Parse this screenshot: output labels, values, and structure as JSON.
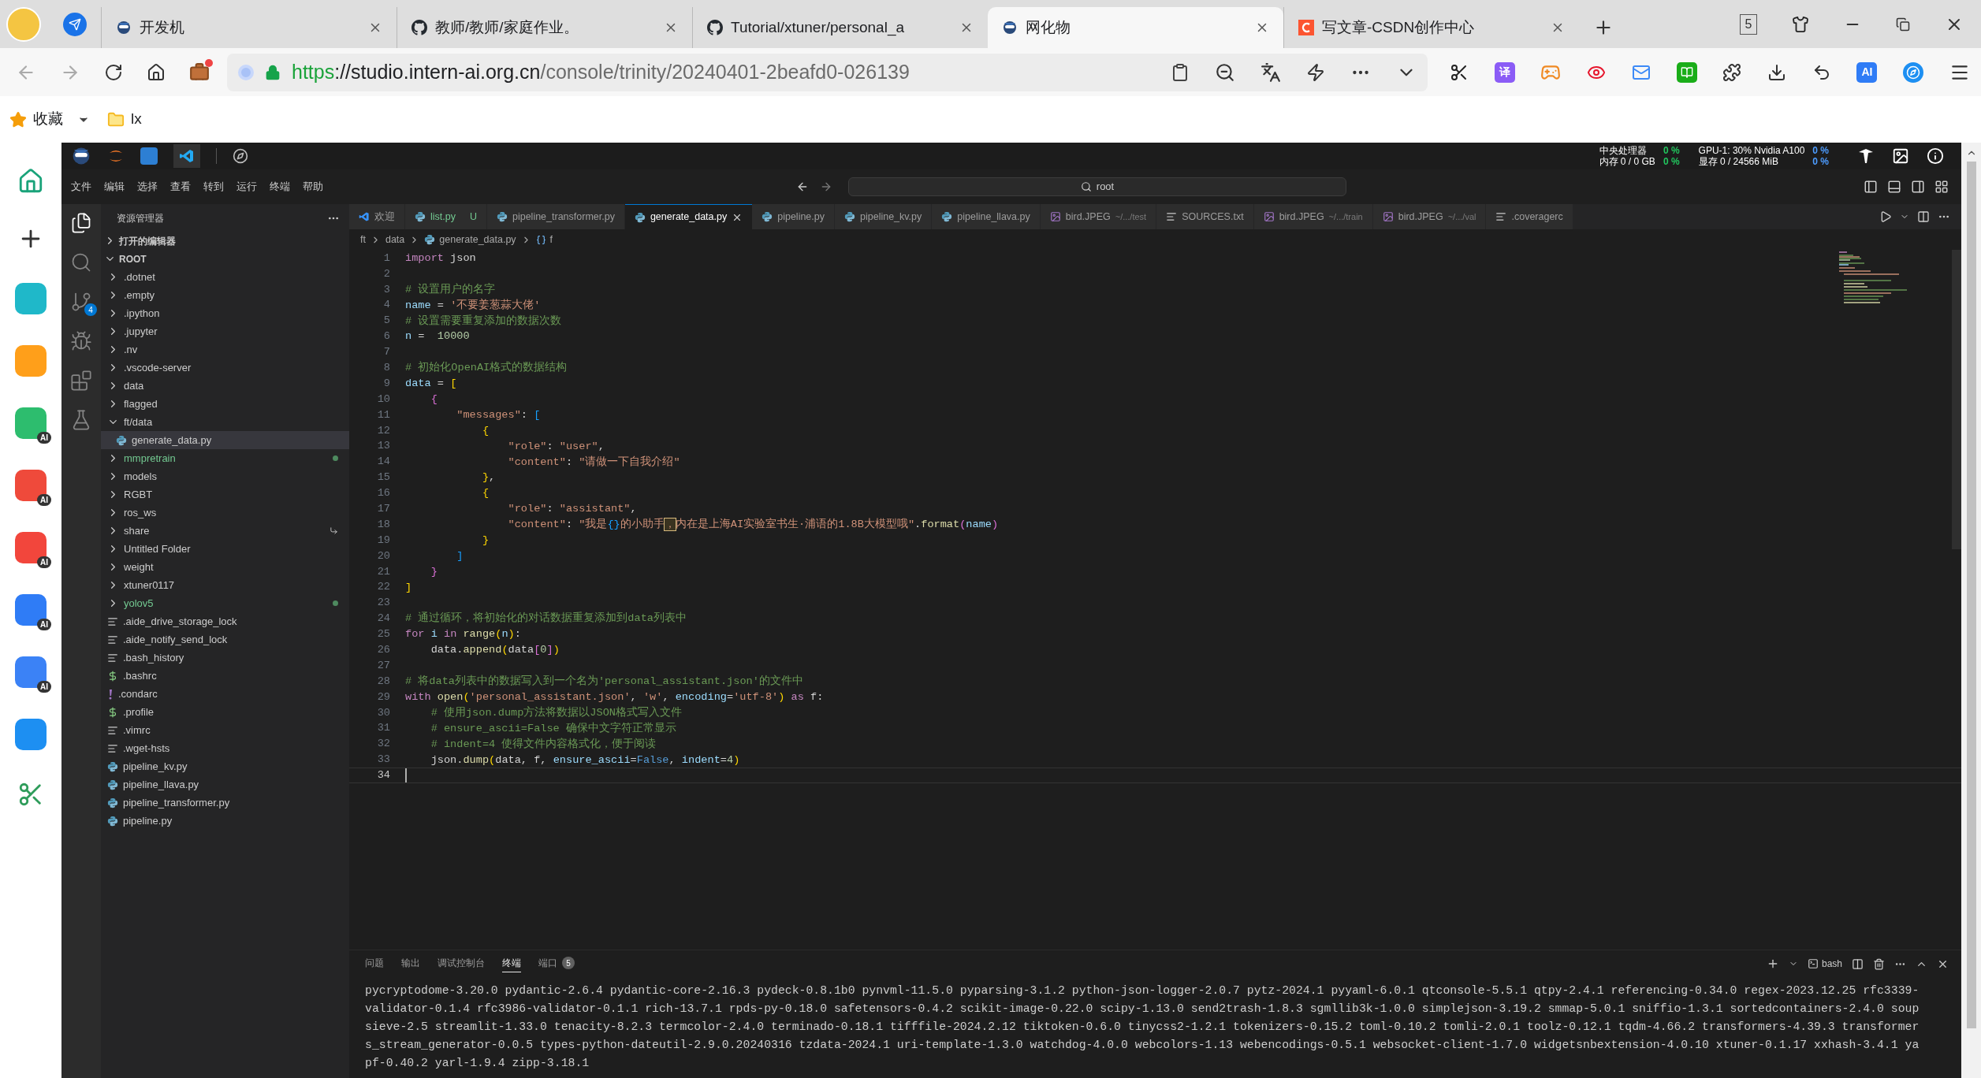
{
  "browser": {
    "tabs": [
      {
        "label": "开发机",
        "selected": false
      },
      {
        "label": "教师/教师/家庭作业。",
        "selected": false
      },
      {
        "label": "Tutorial/xtuner/personal_a",
        "selected": false
      },
      {
        "label": "网化物",
        "selected": true
      },
      {
        "label": "写文章-CSDN创作中心",
        "selected": false
      }
    ],
    "tab_count": "5",
    "address": {
      "scheme": "https",
      "host": "://studio.intern-ai.org.cn",
      "path": "/console/trinity/20240401-2beafd0-026139"
    },
    "extensions": [
      {
        "kind": "scissors"
      },
      {
        "kind": "badge",
        "label": "译",
        "color": "#8b5cf6"
      },
      {
        "kind": "gamepad"
      },
      {
        "kind": "weibo"
      },
      {
        "kind": "mail"
      },
      {
        "kind": "book"
      },
      {
        "kind": "puzzle"
      },
      {
        "kind": "download"
      },
      {
        "kind": "undo"
      },
      {
        "kind": "badge",
        "label": "AI",
        "color": "#2f7cf6"
      },
      {
        "kind": "compass"
      },
      {
        "kind": "menu"
      }
    ],
    "bookmarks": [
      {
        "label": "收藏",
        "kind": "star"
      },
      {
        "label": "lx",
        "kind": "folder"
      }
    ],
    "side_apps": [
      {
        "kind": "home"
      },
      {
        "kind": "add"
      },
      {
        "kind": "app",
        "color": "#1fb8c9"
      },
      {
        "kind": "app",
        "color": "#ff9f1a"
      },
      {
        "kind": "app",
        "color": "#2dbd6e",
        "badge": "AI"
      },
      {
        "kind": "app",
        "color": "#ef4a3b",
        "badge": "AI"
      },
      {
        "kind": "app",
        "color": "#f2463c",
        "badge": "AI"
      },
      {
        "kind": "app",
        "color": "#2f7cf6",
        "badge": "AI"
      },
      {
        "kind": "app",
        "color": "#3b82f6",
        "badge": "AI"
      },
      {
        "kind": "app",
        "color": "#1d8ff2"
      },
      {
        "kind": "scissors"
      }
    ]
  },
  "ide": {
    "monitor": [
      {
        "label": "中央处理器",
        "value": "0 %",
        "color": "#22c55e"
      },
      {
        "label": "内存 0 / 0 GB",
        "value": "0 %",
        "color": "#22c55e"
      },
      {
        "label": "GPU-1: 30% Nvidia A100",
        "value": "0 %",
        "color": "#4d9cff"
      },
      {
        "label": "显存 0 / 24566 MiB",
        "value": "0 %",
        "color": "#4d9cff"
      }
    ],
    "menu": [
      "文件",
      "编辑",
      "选择",
      "查看",
      "转到",
      "运行",
      "终端",
      "帮助"
    ],
    "command_center": "root",
    "activity": [
      {
        "kind": "explorer",
        "selected": true
      },
      {
        "kind": "search",
        "selected": false
      },
      {
        "kind": "scm",
        "selected": false,
        "badge": "4"
      },
      {
        "kind": "debug",
        "selected": false
      },
      {
        "kind": "extensions",
        "selected": false
      },
      {
        "kind": "testing",
        "selected": false
      }
    ],
    "explorer": {
      "title": "资源管理器",
      "open_editors": {
        "label": "打开的编辑器",
        "expanded": false
      },
      "root": {
        "label": "ROOT",
        "expanded": true,
        "children": [
          {
            "label": ".dotnet",
            "kind": "folder",
            "expanded": false,
            "selected": false,
            "modified": false,
            "linked": false
          },
          {
            "label": ".empty",
            "kind": "folder",
            "expanded": false,
            "selected": false,
            "modified": false,
            "linked": false
          },
          {
            "label": ".ipython",
            "kind": "folder",
            "expanded": false,
            "selected": false,
            "modified": false,
            "linked": false
          },
          {
            "label": ".jupyter",
            "kind": "folder",
            "expanded": false,
            "selected": false,
            "modified": false,
            "linked": false
          },
          {
            "label": ".nv",
            "kind": "folder",
            "expanded": false,
            "selected": false,
            "modified": false,
            "linked": false
          },
          {
            "label": ".vscode-server",
            "kind": "folder",
            "expanded": false,
            "selected": false,
            "modified": false,
            "linked": false
          },
          {
            "label": "data",
            "kind": "folder",
            "expanded": false,
            "selected": false,
            "modified": false,
            "linked": false
          },
          {
            "label": "flagged",
            "kind": "folder",
            "expanded": false,
            "selected": false,
            "modified": false,
            "linked": false
          },
          {
            "label": "ft/data",
            "kind": "folder",
            "expanded": true,
            "selected": false,
            "modified": false,
            "linked": false,
            "children": [
              {
                "label": "generate_data.py",
                "kind": "python",
                "selected": true
              }
            ]
          },
          {
            "label": "mmpretrain",
            "kind": "folder",
            "expanded": false,
            "selected": false,
            "modified": true,
            "linked": false
          },
          {
            "label": "models",
            "kind": "folder",
            "expanded": false,
            "selected": false,
            "modified": false,
            "linked": false
          },
          {
            "label": "RGBT",
            "kind": "folder",
            "expanded": false,
            "selected": false,
            "modified": false,
            "linked": false
          },
          {
            "label": "ros_ws",
            "kind": "folder",
            "expanded": false,
            "selected": false,
            "modified": false,
            "linked": false
          },
          {
            "label": "share",
            "kind": "folder",
            "expanded": false,
            "selected": false,
            "modified": false,
            "linked": true
          },
          {
            "label": "Untitled Folder",
            "kind": "folder",
            "expanded": false,
            "selected": false,
            "modified": false,
            "linked": false
          },
          {
            "label": "weight",
            "kind": "folder",
            "expanded": false,
            "selected": false,
            "modified": false,
            "linked": false
          },
          {
            "label": "xtuner0117",
            "kind": "folder",
            "expanded": false,
            "selected": false,
            "modified": false,
            "linked": false
          },
          {
            "label": "yolov5",
            "kind": "folder",
            "expanded": false,
            "selected": false,
            "modified": true,
            "linked": false
          },
          {
            "label": ".aide_drive_storage_lock",
            "kind": "text",
            "selected": false,
            "modified": false,
            "linked": false
          },
          {
            "label": ".aide_notify_send_lock",
            "kind": "text",
            "selected": false,
            "modified": false,
            "linked": false
          },
          {
            "label": ".bash_history",
            "kind": "text",
            "selected": false,
            "modified": false,
            "linked": false
          },
          {
            "label": ".bashrc",
            "kind": "shell",
            "selected": false,
            "modified": false,
            "linked": false
          },
          {
            "label": ".condarc",
            "kind": "config",
            "selected": false,
            "modified": false,
            "linked": false
          },
          {
            "label": ".profile",
            "kind": "shell",
            "selected": false,
            "modified": false,
            "linked": false
          },
          {
            "label": ".vimrc",
            "kind": "text",
            "selected": false,
            "modified": false,
            "linked": false
          },
          {
            "label": ".wget-hsts",
            "kind": "text",
            "selected": false,
            "modified": false,
            "linked": false
          },
          {
            "label": "pipeline_kv.py",
            "kind": "python",
            "selected": false,
            "modified": false,
            "linked": false
          },
          {
            "label": "pipeline_llava.py",
            "kind": "python",
            "selected": false,
            "modified": false,
            "linked": false
          },
          {
            "label": "pipeline_transformer.py",
            "kind": "python",
            "selected": false,
            "modified": false,
            "linked": false
          },
          {
            "label": "pipeline.py",
            "kind": "python",
            "selected": false,
            "modified": false,
            "linked": false
          }
        ]
      }
    },
    "tabs": [
      {
        "label": "欢迎",
        "kind": "welcome",
        "selected": false
      },
      {
        "label": "list.py",
        "kind": "python",
        "status": "U",
        "selected": false
      },
      {
        "label": "pipeline_transformer.py",
        "kind": "python",
        "selected": false
      },
      {
        "label": "generate_data.py",
        "kind": "python",
        "selected": true
      },
      {
        "label": "pipeline.py",
        "kind": "python",
        "selected": false
      },
      {
        "label": "pipeline_kv.py",
        "kind": "python",
        "selected": false
      },
      {
        "label": "pipeline_llava.py",
        "kind": "python",
        "selected": false
      },
      {
        "label": "bird.JPEG",
        "description": "~/.../test",
        "kind": "image",
        "selected": false
      },
      {
        "label": "SOURCES.txt",
        "kind": "text",
        "selected": false
      },
      {
        "label": "bird.JPEG",
        "description": "~/.../train",
        "kind": "image",
        "selected": false
      },
      {
        "label": "bird.JPEG",
        "description": "~/.../val",
        "kind": "image",
        "selected": false
      },
      {
        "label": ".coveragerc",
        "kind": "text",
        "selected": false
      }
    ],
    "breadcrumb": [
      {
        "label": "ft",
        "kind": "folder"
      },
      {
        "label": "data",
        "kind": "folder"
      },
      {
        "label": "generate_data.py",
        "kind": "python"
      },
      {
        "label": "f",
        "kind": "variable"
      }
    ],
    "lines": [
      {
        "number": "1",
        "current": false,
        "tokens": [
          {
            "kind": "kw",
            "text": "import"
          },
          {
            "kind": "plain",
            "text": " json"
          }
        ]
      },
      {
        "number": "2",
        "current": false
      },
      {
        "number": "3",
        "current": false,
        "tokens": [
          {
            "kind": "com",
            "text": "# 设置用户的名字"
          }
        ]
      },
      {
        "number": "4",
        "current": false,
        "tokens": [
          {
            "kind": "var",
            "text": "name"
          },
          {
            "kind": "plain",
            "text": " = "
          },
          {
            "kind": "str",
            "text": "'不要姜葱蒜大佬'"
          }
        ]
      },
      {
        "number": "5",
        "current": false,
        "tokens": [
          {
            "kind": "com",
            "text": "# 设置需要重复添加的数据次数"
          }
        ]
      },
      {
        "number": "6",
        "current": false,
        "tokens": [
          {
            "kind": "var",
            "text": "n"
          },
          {
            "kind": "plain",
            "text": " =  "
          },
          {
            "kind": "num",
            "text": "10000"
          }
        ]
      },
      {
        "number": "7",
        "current": false
      },
      {
        "number": "8",
        "current": false,
        "tokens": [
          {
            "kind": "com",
            "text": "# 初始化OpenAI格式的数据结构"
          }
        ]
      },
      {
        "number": "9",
        "current": false,
        "tokens": [
          {
            "kind": "var",
            "text": "data"
          },
          {
            "kind": "plain",
            "text": " = "
          },
          {
            "kind": "b1",
            "text": "["
          }
        ]
      },
      {
        "number": "10",
        "current": false,
        "tokens": [
          {
            "kind": "b2",
            "text": "    {"
          }
        ]
      },
      {
        "number": "11",
        "current": false,
        "tokens": [
          {
            "kind": "str",
            "text": "        \"messages\""
          },
          {
            "kind": "plain",
            "text": ": "
          },
          {
            "kind": "b3",
            "text": "["
          }
        ]
      },
      {
        "number": "12",
        "current": false,
        "tokens": [
          {
            "kind": "b1",
            "text": "            {"
          }
        ]
      },
      {
        "number": "13",
        "current": false,
        "tokens": [
          {
            "kind": "str",
            "text": "                \"role\""
          },
          {
            "kind": "plain",
            "text": ": "
          },
          {
            "kind": "str",
            "text": "\"user\""
          },
          {
            "kind": "plain",
            "text": ","
          }
        ]
      },
      {
        "number": "14",
        "current": false,
        "tokens": [
          {
            "kind": "str",
            "text": "                \"content\""
          },
          {
            "kind": "plain",
            "text": ": "
          },
          {
            "kind": "str",
            "text": "\"请做一下自我介绍\""
          }
        ]
      },
      {
        "number": "15",
        "current": false,
        "tokens": [
          {
            "kind": "b1",
            "text": "            }"
          },
          {
            "kind": "plain",
            "text": ","
          }
        ]
      },
      {
        "number": "16",
        "current": false,
        "tokens": [
          {
            "kind": "b1",
            "text": "            {"
          }
        ]
      },
      {
        "number": "17",
        "current": false,
        "tokens": [
          {
            "kind": "str",
            "text": "                \"role\""
          },
          {
            "kind": "plain",
            "text": ": "
          },
          {
            "kind": "str",
            "text": "\"assistant\""
          },
          {
            "kind": "plain",
            "text": ","
          }
        ]
      },
      {
        "number": "18",
        "current": false,
        "tokens": [
          {
            "kind": "str",
            "text": "                \"content\""
          },
          {
            "kind": "plain",
            "text": ": "
          },
          {
            "kind": "str",
            "text": "\"我是"
          },
          {
            "kind": "b3",
            "text": "{}"
          },
          {
            "kind": "str",
            "text": "的小助手"
          },
          {
            "kind": "hl",
            "text": "，"
          },
          {
            "kind": "str",
            "text": "内在是上海AI实验室书生·浦语的1.8B大模型哦\""
          },
          {
            "kind": "plain",
            "text": "."
          },
          {
            "kind": "fn",
            "text": "format"
          },
          {
            "kind": "b2",
            "text": "("
          },
          {
            "kind": "var",
            "text": "name"
          },
          {
            "kind": "b2",
            "text": ")"
          }
        ]
      },
      {
        "number": "19",
        "current": false,
        "tokens": [
          {
            "kind": "b1",
            "text": "            }"
          }
        ]
      },
      {
        "number": "20",
        "current": false,
        "tokens": [
          {
            "kind": "b3",
            "text": "        ]"
          }
        ]
      },
      {
        "number": "21",
        "current": false,
        "tokens": [
          {
            "kind": "b2",
            "text": "    }"
          }
        ]
      },
      {
        "number": "22",
        "current": false,
        "tokens": [
          {
            "kind": "b1",
            "text": "]"
          }
        ]
      },
      {
        "number": "23",
        "current": false
      },
      {
        "number": "24",
        "current": false,
        "tokens": [
          {
            "kind": "com",
            "text": "# 通过循环，将初始化的对话数据重复添加到data列表中"
          }
        ]
      },
      {
        "number": "25",
        "current": false,
        "tokens": [
          {
            "kind": "kw",
            "text": "for"
          },
          {
            "kind": "var",
            "text": " i"
          },
          {
            "kind": "kw",
            "text": " in"
          },
          {
            "kind": "fn",
            "text": " range"
          },
          {
            "kind": "b1",
            "text": "("
          },
          {
            "kind": "var",
            "text": "n"
          },
          {
            "kind": "b1",
            "text": ")"
          },
          {
            "kind": "plain",
            "text": ":"
          }
        ]
      },
      {
        "number": "26",
        "current": false,
        "tokens": [
          {
            "kind": "plain",
            "text": "    data."
          },
          {
            "kind": "fn",
            "text": "append"
          },
          {
            "kind": "b1",
            "text": "("
          },
          {
            "kind": "plain",
            "text": "data"
          },
          {
            "kind": "b2",
            "text": "["
          },
          {
            "kind": "num",
            "text": "0"
          },
          {
            "kind": "b2",
            "text": "]"
          },
          {
            "kind": "b1",
            "text": ")"
          }
        ]
      },
      {
        "number": "27",
        "current": false
      },
      {
        "number": "28",
        "current": false,
        "tokens": [
          {
            "kind": "com",
            "text": "# 将data列表中的数据写入到一个名为'personal_assistant.json'的文件中"
          }
        ]
      },
      {
        "number": "29",
        "current": false,
        "tokens": [
          {
            "kind": "kw",
            "text": "with"
          },
          {
            "kind": "fn",
            "text": " open"
          },
          {
            "kind": "b1",
            "text": "("
          },
          {
            "kind": "str",
            "text": "'personal_assistant.json'"
          },
          {
            "kind": "plain",
            "text": ", "
          },
          {
            "kind": "str",
            "text": "'w'"
          },
          {
            "kind": "plain",
            "text": ", "
          },
          {
            "kind": "var",
            "text": "encoding"
          },
          {
            "kind": "plain",
            "text": "="
          },
          {
            "kind": "str",
            "text": "'utf-8'"
          },
          {
            "kind": "b1",
            "text": ")"
          },
          {
            "kind": "kw",
            "text": " as"
          },
          {
            "kind": "plain",
            "text": " f:"
          }
        ]
      },
      {
        "number": "30",
        "current": false,
        "tokens": [
          {
            "kind": "com",
            "text": "    # 使用json.dump方法将数据以JSON格式写入文件"
          }
        ]
      },
      {
        "number": "31",
        "current": false,
        "tokens": [
          {
            "kind": "com",
            "text": "    # ensure_ascii=False 确保中文字符正常显示"
          }
        ]
      },
      {
        "number": "32",
        "current": false,
        "tokens": [
          {
            "kind": "com",
            "text": "    # indent=4 使得文件内容格式化，便于阅读"
          }
        ]
      },
      {
        "number": "33",
        "current": false,
        "tokens": [
          {
            "kind": "plain",
            "text": "    json."
          },
          {
            "kind": "fn",
            "text": "dump"
          },
          {
            "kind": "b1",
            "text": "("
          },
          {
            "kind": "plain",
            "text": "data, f, "
          },
          {
            "kind": "var",
            "text": "ensure_ascii"
          },
          {
            "kind": "plain",
            "text": "="
          },
          {
            "kind": "const",
            "text": "False"
          },
          {
            "kind": "plain",
            "text": ", "
          },
          {
            "kind": "var",
            "text": "indent"
          },
          {
            "kind": "plain",
            "text": "="
          },
          {
            "kind": "num",
            "text": "4"
          },
          {
            "kind": "b1",
            "text": ")"
          }
        ]
      },
      {
        "number": "34",
        "current": true
      }
    ],
    "panel": {
      "tabs": [
        {
          "label": "问题",
          "selected": false
        },
        {
          "label": "输出",
          "selected": false
        },
        {
          "label": "调试控制台",
          "selected": false
        },
        {
          "label": "终端",
          "selected": true
        },
        {
          "label": "端口",
          "selected": false,
          "badge": "5"
        }
      ],
      "shell": "bash",
      "terminal": [
        "pycryptodome-3.20.0 pydantic-2.6.4 pydantic-core-2.16.3 pydeck-0.8.1b0 pynvml-11.5.0 pyparsing-3.1.2 python-json-logger-2.0.7 pytz-2024.1 pyyaml-6.0.1 qtconsole-5.5.1 qtpy-2.4.1 referencing-0.34.0 regex-2023.12.25 rfc3339-",
        "validator-0.1.4 rfc3986-validator-0.1.1 rich-13.7.1 rpds-py-0.18.0 safetensors-0.4.2 scikit-image-0.22.0 scipy-1.13.0 send2trash-1.8.3 sgmllib3k-1.0.0 simplejson-3.19.2 smmap-5.0.1 sniffio-1.3.1 sortedcontainers-2.4.0 soup",
        "sieve-2.5 streamlit-1.33.0 tenacity-8.2.3 termcolor-2.4.0 terminado-0.18.1 tifffile-2024.2.12 tiktoken-0.6.0 tinycss2-1.2.1 tokenizers-0.15.2 toml-0.10.2 tomli-2.0.1 toolz-0.12.1 tqdm-4.66.2 transformers-4.39.3 transformer",
        "s_stream_generator-0.0.5 types-python-dateutil-2.9.0.20240316 tzdata-2024.1 uri-template-1.3.0 watchdog-4.0.0 webcolors-1.13 webencodings-0.5.1 websocket-client-1.7.0 widgetsnbextension-4.0.10 xtuner-0.1.17 xxhash-3.4.1 ya",
        "pf-0.40.2 yarl-1.9.4 zipp-3.18.1"
      ]
    }
  }
}
